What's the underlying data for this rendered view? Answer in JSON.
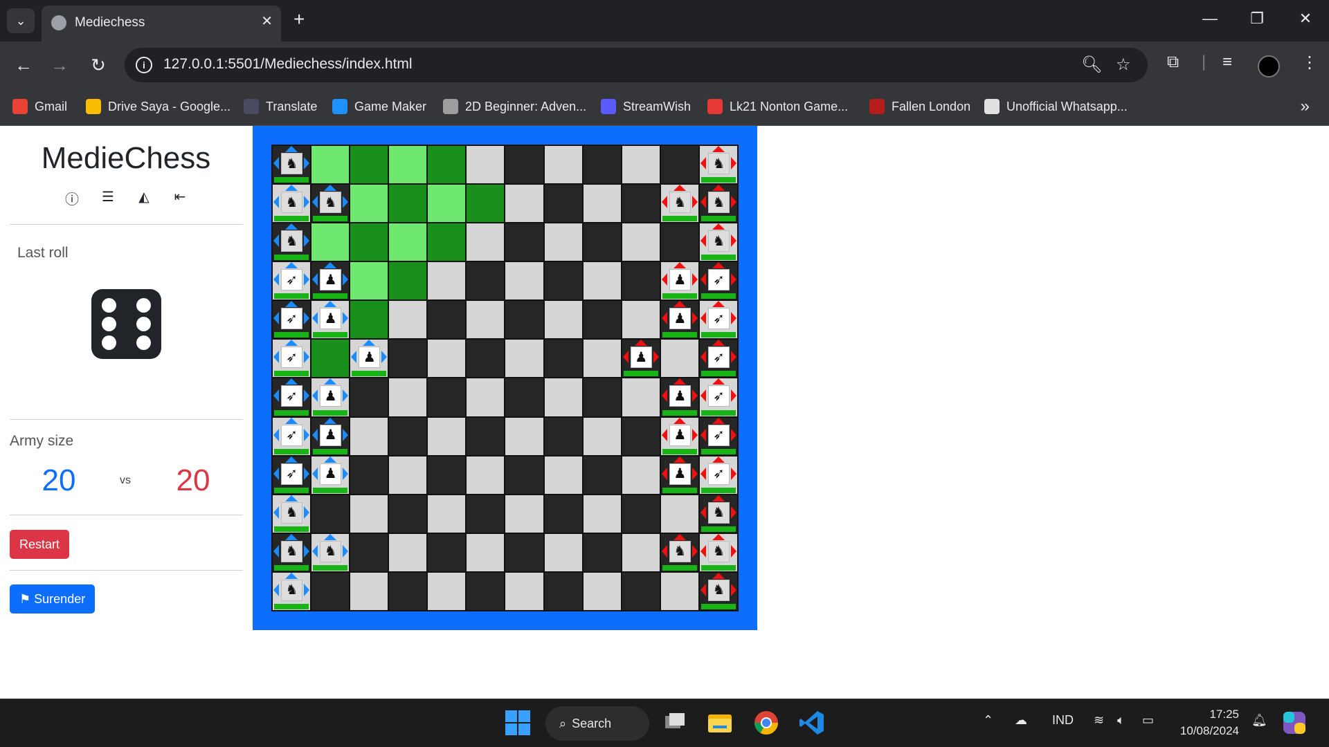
{
  "browser": {
    "tab_title": "Mediechess",
    "url": "127.0.0.1:5501/Mediechess/index.html",
    "bookmarks": [
      {
        "label": "Gmail",
        "icon": "gmail-icon",
        "color": "#ea4335"
      },
      {
        "label": "Drive Saya - Google...",
        "icon": "google-drive-icon",
        "color": "#fbbc04"
      },
      {
        "label": "Translate",
        "icon": "translate-icon",
        "color": "#4a4a60"
      },
      {
        "label": "Game Maker",
        "icon": "game-maker-icon",
        "color": "#1e90ff"
      },
      {
        "label": "2D Beginner: Adven...",
        "icon": "unity-icon",
        "color": "#9e9e9e"
      },
      {
        "label": "StreamWish",
        "icon": "streamwish-icon",
        "color": "#5b5bff"
      },
      {
        "label": "Lk21 Nonton Game...",
        "icon": "lk21-icon",
        "color": "#e53935"
      },
      {
        "label": "Fallen London",
        "icon": "candle-icon",
        "color": "#b71c1c"
      },
      {
        "label": "Unofficial Whatsapp...",
        "icon": "chat-bubble-icon",
        "color": "#e0e0e0"
      }
    ]
  },
  "sidebar": {
    "title": "MedieChess",
    "menu_icons": [
      "help-icon",
      "list-icon",
      "triangle-icon",
      "exit-icon"
    ],
    "last_roll_label": "Last roll",
    "last_roll_value": 6,
    "army_label": "Army size",
    "army_blue": "20",
    "army_vs": "vs",
    "army_red": "20",
    "restart_label": "Restart",
    "surrender_label": "Surender"
  },
  "board": {
    "size": 12,
    "highlight": [
      [
        0,
        1
      ],
      [
        0,
        2
      ],
      [
        0,
        3
      ],
      [
        0,
        4
      ],
      [
        1,
        2
      ],
      [
        1,
        3
      ],
      [
        1,
        4
      ],
      [
        1,
        5
      ],
      [
        2,
        1
      ],
      [
        2,
        2
      ],
      [
        2,
        3
      ],
      [
        2,
        4
      ],
      [
        3,
        2
      ],
      [
        3,
        3
      ],
      [
        4,
        2
      ],
      [
        5,
        1
      ]
    ],
    "pieces": [
      {
        "r": 0,
        "c": 0,
        "team": "blue",
        "type": "knight",
        "arrows": [
          "up",
          "left",
          "right"
        ]
      },
      {
        "r": 1,
        "c": 0,
        "team": "blue",
        "type": "knight",
        "arrows": [
          "up",
          "left",
          "right"
        ]
      },
      {
        "r": 1,
        "c": 1,
        "team": "blue",
        "type": "knight",
        "arrows": [
          "up",
          "left",
          "right"
        ]
      },
      {
        "r": 2,
        "c": 0,
        "team": "blue",
        "type": "knight",
        "arrows": [
          "up",
          "left",
          "right"
        ]
      },
      {
        "r": 3,
        "c": 0,
        "team": "blue",
        "type": "archer",
        "arrows": [
          "up",
          "left",
          "right"
        ]
      },
      {
        "r": 3,
        "c": 1,
        "team": "blue",
        "type": "soldier",
        "arrows": [
          "up",
          "left",
          "right"
        ]
      },
      {
        "r": 4,
        "c": 0,
        "team": "blue",
        "type": "archer",
        "arrows": [
          "up",
          "left",
          "right"
        ]
      },
      {
        "r": 4,
        "c": 1,
        "team": "blue",
        "type": "soldier",
        "arrows": [
          "up",
          "left",
          "right"
        ]
      },
      {
        "r": 5,
        "c": 0,
        "team": "blue",
        "type": "archer",
        "arrows": [
          "up",
          "left",
          "right"
        ]
      },
      {
        "r": 5,
        "c": 2,
        "team": "blue",
        "type": "soldier",
        "arrows": [
          "up",
          "left",
          "right"
        ]
      },
      {
        "r": 6,
        "c": 0,
        "team": "blue",
        "type": "archer",
        "arrows": [
          "up",
          "left",
          "right"
        ]
      },
      {
        "r": 6,
        "c": 1,
        "team": "blue",
        "type": "soldier",
        "arrows": [
          "up",
          "left",
          "right"
        ]
      },
      {
        "r": 7,
        "c": 0,
        "team": "blue",
        "type": "archer",
        "arrows": [
          "up",
          "left",
          "right"
        ]
      },
      {
        "r": 7,
        "c": 1,
        "team": "blue",
        "type": "soldier",
        "arrows": [
          "up",
          "left",
          "right"
        ]
      },
      {
        "r": 8,
        "c": 0,
        "team": "blue",
        "type": "archer",
        "arrows": [
          "up",
          "left",
          "right"
        ]
      },
      {
        "r": 8,
        "c": 1,
        "team": "blue",
        "type": "soldier",
        "arrows": [
          "up",
          "left",
          "right"
        ]
      },
      {
        "r": 9,
        "c": 0,
        "team": "blue",
        "type": "knight",
        "arrows": [
          "up",
          "left",
          "right"
        ]
      },
      {
        "r": 10,
        "c": 0,
        "team": "blue",
        "type": "knight",
        "arrows": [
          "up",
          "left",
          "right"
        ]
      },
      {
        "r": 10,
        "c": 1,
        "team": "blue",
        "type": "knight",
        "arrows": [
          "up",
          "left",
          "right"
        ]
      },
      {
        "r": 11,
        "c": 0,
        "team": "blue",
        "type": "knight",
        "arrows": [
          "up",
          "left",
          "right"
        ]
      },
      {
        "r": 0,
        "c": 11,
        "team": "red",
        "type": "knight",
        "arrows": [
          "up",
          "left",
          "right"
        ]
      },
      {
        "r": 1,
        "c": 10,
        "team": "red",
        "type": "knight",
        "arrows": [
          "up",
          "left",
          "right"
        ]
      },
      {
        "r": 1,
        "c": 11,
        "team": "red",
        "type": "knight",
        "arrows": [
          "up",
          "left",
          "right"
        ]
      },
      {
        "r": 2,
        "c": 11,
        "team": "red",
        "type": "knight",
        "arrows": [
          "up",
          "left",
          "right"
        ]
      },
      {
        "r": 3,
        "c": 10,
        "team": "red",
        "type": "soldier",
        "arrows": [
          "up",
          "left",
          "right"
        ]
      },
      {
        "r": 3,
        "c": 11,
        "team": "red",
        "type": "archer",
        "arrows": [
          "up",
          "left",
          "right"
        ]
      },
      {
        "r": 4,
        "c": 10,
        "team": "red",
        "type": "soldier",
        "arrows": [
          "up",
          "left",
          "right"
        ]
      },
      {
        "r": 4,
        "c": 11,
        "team": "red",
        "type": "archer",
        "arrows": [
          "up",
          "left",
          "right"
        ]
      },
      {
        "r": 5,
        "c": 9,
        "team": "red",
        "type": "soldier",
        "arrows": [
          "up",
          "left",
          "right"
        ]
      },
      {
        "r": 5,
        "c": 11,
        "team": "red",
        "type": "archer",
        "arrows": [
          "up",
          "left",
          "right"
        ]
      },
      {
        "r": 6,
        "c": 10,
        "team": "red",
        "type": "soldier",
        "arrows": [
          "up",
          "left",
          "right"
        ]
      },
      {
        "r": 6,
        "c": 11,
        "team": "red",
        "type": "archer",
        "arrows": [
          "up",
          "left",
          "right"
        ]
      },
      {
        "r": 7,
        "c": 10,
        "team": "red",
        "type": "soldier",
        "arrows": [
          "up",
          "left",
          "right"
        ]
      },
      {
        "r": 7,
        "c": 11,
        "team": "red",
        "type": "archer",
        "arrows": [
          "up",
          "left",
          "right"
        ]
      },
      {
        "r": 8,
        "c": 10,
        "team": "red",
        "type": "soldier",
        "arrows": [
          "up",
          "left",
          "right"
        ]
      },
      {
        "r": 8,
        "c": 11,
        "team": "red",
        "type": "archer",
        "arrows": [
          "up",
          "left",
          "right"
        ]
      },
      {
        "r": 9,
        "c": 11,
        "team": "red",
        "type": "knight",
        "arrows": [
          "up",
          "left",
          "right"
        ]
      },
      {
        "r": 10,
        "c": 10,
        "team": "red",
        "type": "knight",
        "arrows": [
          "up",
          "left",
          "right"
        ]
      },
      {
        "r": 10,
        "c": 11,
        "team": "red",
        "type": "knight",
        "arrows": [
          "up",
          "left",
          "right"
        ]
      },
      {
        "r": 11,
        "c": 11,
        "team": "red",
        "type": "knight",
        "arrows": [
          "up",
          "left",
          "right"
        ]
      }
    ],
    "colors": {
      "frame": "#0d6efd",
      "light": "#d6d6d6",
      "dark": "#262626",
      "highlight_light": "#6fe870",
      "highlight_dark": "#19901b",
      "blue_team": "#1a8cff",
      "red_team": "#ee1111",
      "hp_bar": "#17b317"
    },
    "piece_glyphs": {
      "knight": "♞",
      "archer": "➶",
      "soldier": "♟"
    }
  },
  "taskbar": {
    "search_label": "Search",
    "language": "IND",
    "time": "17:25",
    "date": "10/08/2024"
  }
}
